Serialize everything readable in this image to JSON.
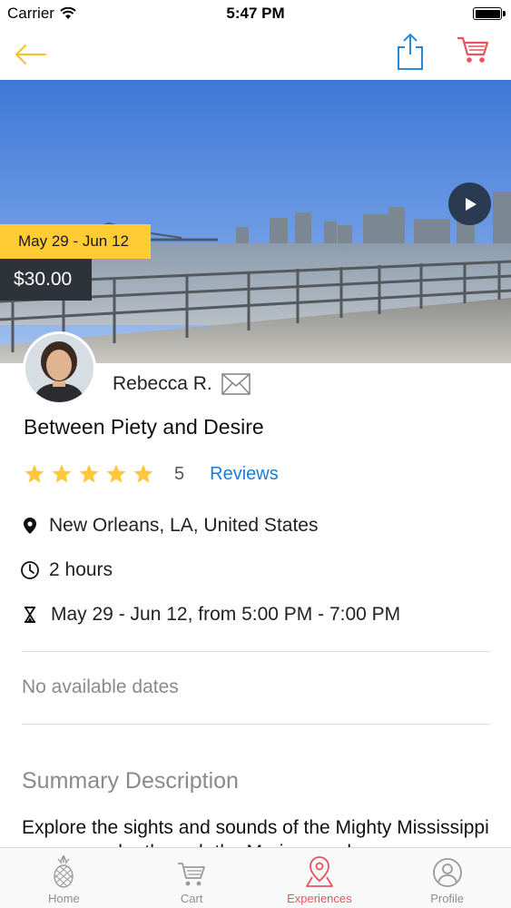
{
  "status_bar": {
    "carrier": "Carrier",
    "time": "5:47 PM"
  },
  "nav": {
    "back_icon": "back-arrow-icon",
    "share_icon": "share-icon",
    "cart_icon": "cart-icon",
    "accent_color": "#f5c330",
    "cart_color": "#e8535c",
    "share_color": "#2a8ad8"
  },
  "hero": {
    "date_range": "May 29 - Jun 12",
    "price": "$30.00",
    "play_icon": "play-icon",
    "date_badge_color": "#ffcc33",
    "price_badge_color": "#2d3338"
  },
  "host": {
    "name": "Rebecca R.",
    "mail_icon": "mail-icon"
  },
  "experience": {
    "title": "Between Piety and Desire",
    "rating_stars": 5,
    "rating_count": "5",
    "reviews_label": "Reviews",
    "location": "New Orleans, LA, United States",
    "duration": "2 hours",
    "schedule": "May 29 - Jun 12, from 5:00 PM - 7:00 PM",
    "availability": "No available dates",
    "summary_heading": "Summary Description",
    "summary_text": "Explore the sights and sounds of the Mighty Mississippi as we wander through the Marigny and"
  },
  "tabs": [
    {
      "label": "Home",
      "icon": "pineapple-icon",
      "active": false
    },
    {
      "label": "Cart",
      "icon": "cart-icon",
      "active": false
    },
    {
      "label": "Experiences",
      "icon": "map-pin-icon",
      "active": true
    },
    {
      "label": "Profile",
      "icon": "profile-icon",
      "active": false
    }
  ]
}
